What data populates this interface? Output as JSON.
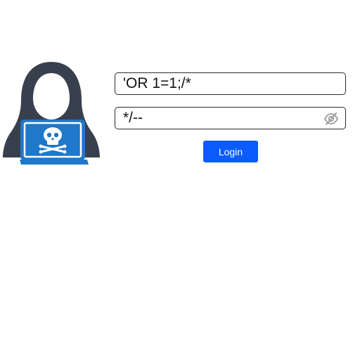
{
  "illustration": {
    "icon": "hooded-hacker-laptop-icon",
    "colors": {
      "hood": "#39404d",
      "laptop": "#1f78c9",
      "skull": "#ffffff"
    }
  },
  "form": {
    "username": {
      "value": "'OR 1=1;/*",
      "placeholder": ""
    },
    "password": {
      "value": "*/--",
      "placeholder": "",
      "toggle_icon": "eye-slash-icon"
    },
    "login_label": "Login"
  },
  "colors": {
    "button": "#0a5cff",
    "button_text": "#ffffff",
    "field_border": "#2b2b2b",
    "eye_icon": "#9a9a9a"
  }
}
